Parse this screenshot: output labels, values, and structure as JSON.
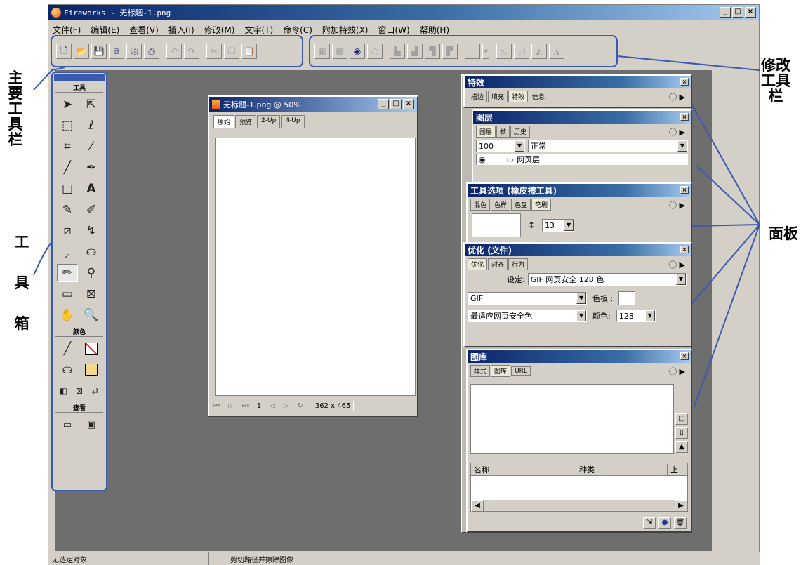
{
  "window": {
    "title": "Fireworks - 无标题-1.png",
    "btn_min": "_",
    "btn_max": "□",
    "btn_close": "×"
  },
  "menu": [
    "文件(F)",
    "编辑(E)",
    "查看(V)",
    "插入(I)",
    "修改(M)",
    "文字(T)",
    "命令(C)",
    "附加特效(X)",
    "窗口(W)",
    "帮助(H)"
  ],
  "document": {
    "title": "无标题-1.png @ 50%",
    "tabs": [
      "原始",
      "预览",
      "2-Up",
      "4-Up"
    ],
    "page_num": "1",
    "size": "362 x 465"
  },
  "toolbox": {
    "sections": [
      "工具",
      "颜色",
      "查看"
    ]
  },
  "panels": {
    "effects": {
      "title": "特效",
      "tabs": [
        "描边",
        "填充",
        "特效",
        "信息"
      ]
    },
    "layers": {
      "title": "图层",
      "tabs": [
        "图层",
        "帧",
        "历史"
      ],
      "opacity": "100",
      "blend": "正常",
      "layer_name": "网页层"
    },
    "tool_options": {
      "title": "工具选项 (橡皮擦工具)",
      "tabs": [
        "混色",
        "色样",
        "色盘",
        "笔刷"
      ],
      "size": "13"
    },
    "optimize": {
      "title": "优化 (文件)",
      "tabs": [
        "优化",
        "对齐",
        "行为"
      ],
      "settings_label": "设定:",
      "settings_value": "GIF 网页安全 128 色",
      "format": "GIF",
      "palette_label": "色板 :",
      "palette_value": "最适应网页安全色",
      "colors_label": "颜色:",
      "colors_value": "128"
    },
    "library": {
      "title": "图库",
      "tabs": [
        "样式",
        "图库",
        "URL"
      ],
      "col_name": "名称",
      "col_type": "种类",
      "col_up": "上"
    }
  },
  "status": {
    "left": "无选定对象",
    "right": "剪切路径并擦除图像"
  },
  "annotations": {
    "main_toolbar": "主要工具栏",
    "modify_toolbar": "修改工具栏",
    "toolbox": "工具箱",
    "panels": "面板"
  },
  "colors": {
    "annotation_line": "#3a5ab0",
    "titlebar": "#0a246a",
    "workspace": "#6e6e6e"
  }
}
